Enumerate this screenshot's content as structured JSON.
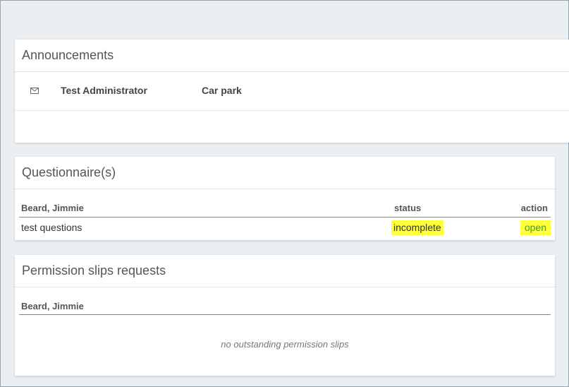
{
  "announcements": {
    "title": "Announcements",
    "items": [
      {
        "icon": "mail-icon",
        "from": "Test Administrator",
        "subject": "Car park"
      }
    ]
  },
  "questionnaires": {
    "title": "Questionnaire(s)",
    "columns": {
      "name": "Beard, Jimmie",
      "status": "status",
      "action": "action"
    },
    "rows": [
      {
        "name": "test questions",
        "status": "incomplete",
        "action": "open"
      }
    ],
    "highlight_color": "#ffff3a",
    "action_color": "#4a9a2a"
  },
  "permission_slips": {
    "title": "Permission slips requests",
    "columns": {
      "name": "Beard, Jimmie"
    },
    "empty_text": "no outstanding permission slips"
  }
}
